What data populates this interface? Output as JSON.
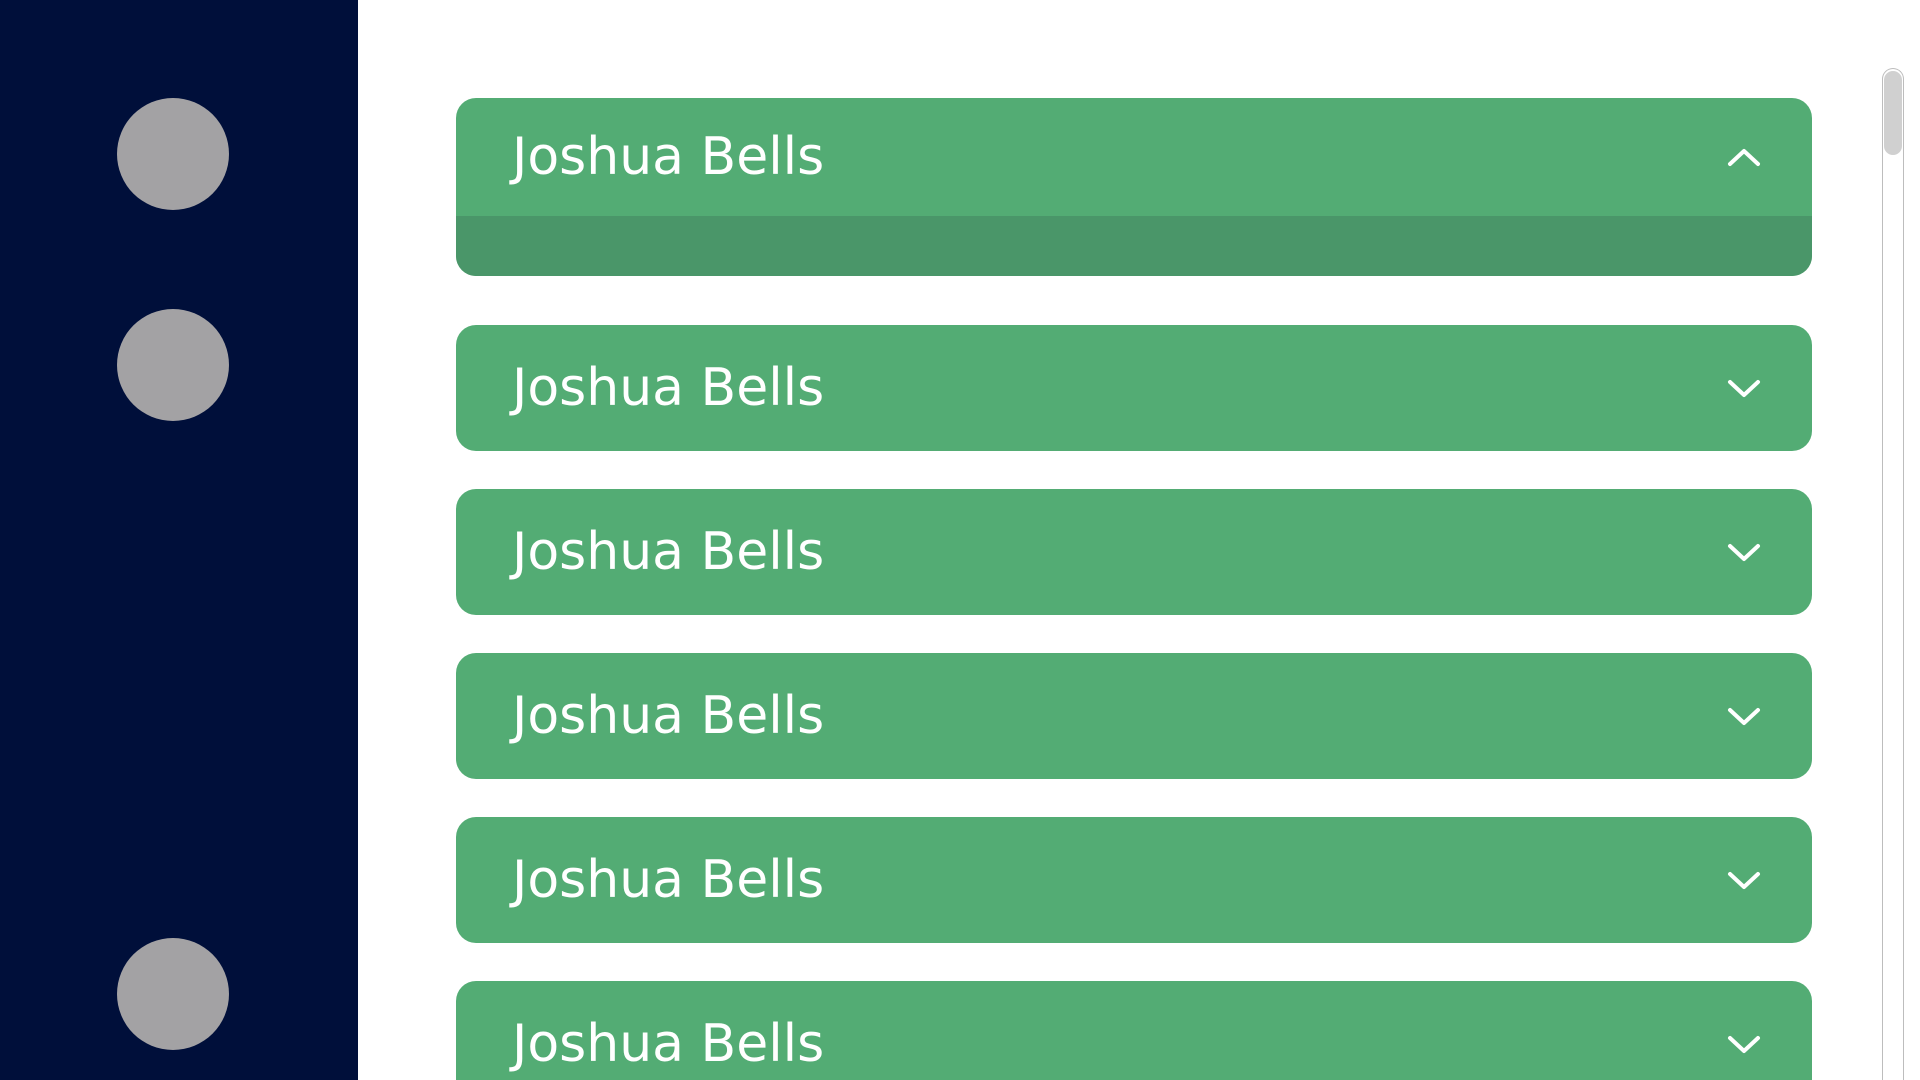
{
  "sidebar": {
    "avatars": [
      "avatar-1",
      "avatar-2",
      "avatar-3"
    ]
  },
  "accordion": {
    "items": [
      {
        "title": "Joshua Bells",
        "state": "expanded",
        "icon": "chevron-up-icon"
      },
      {
        "title": "Joshua Bells",
        "state": "collapsed",
        "icon": "chevron-down-icon"
      },
      {
        "title": "Joshua Bells",
        "state": "collapsed",
        "icon": "chevron-down-icon"
      },
      {
        "title": "Joshua Bells",
        "state": "collapsed",
        "icon": "chevron-down-icon"
      },
      {
        "title": "Joshua Bells",
        "state": "collapsed",
        "icon": "chevron-down-icon"
      },
      {
        "title": "Joshua Bells",
        "state": "collapsed",
        "icon": "chevron-down-icon"
      }
    ]
  },
  "colors": {
    "sidebar_bg": "#000f3a",
    "avatar": "#a3a2a4",
    "accordion_header": "#53ac74",
    "accordion_body": "#4a9669",
    "text": "#ffffff"
  }
}
